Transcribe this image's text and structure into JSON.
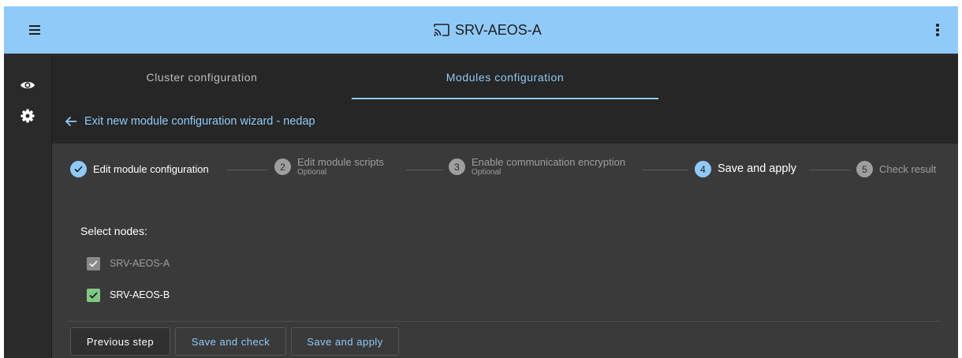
{
  "app": {
    "title": "SRV-AEOS-A",
    "colors": {
      "primary": "#90caf9",
      "success": "#81c784",
      "surface": "#3a3a3a"
    }
  },
  "icons": {
    "menu": "hamburger-menu-icon",
    "cast": "cast-icon",
    "more": "more-vertical-icon",
    "eye": "eye-icon",
    "settings": "gear-icon",
    "back": "arrow-left-icon",
    "check": "check-icon"
  },
  "tabs": [
    {
      "label": "Cluster configuration",
      "active": false
    },
    {
      "label": "Modules configuration",
      "active": true
    }
  ],
  "wizard": {
    "exit_label": "Exit new module configuration wizard - nedap",
    "steps": [
      {
        "number": "1",
        "label": "Edit module configuration",
        "sublabel": "",
        "state": "done"
      },
      {
        "number": "2",
        "label": "Edit module scripts",
        "sublabel": "Optional",
        "state": "pending"
      },
      {
        "number": "3",
        "label": "Enable communication encryption",
        "sublabel": "Optional",
        "state": "pending"
      },
      {
        "number": "4",
        "label": "Save and apply",
        "sublabel": "",
        "state": "active"
      },
      {
        "number": "5",
        "label": "Check result",
        "sublabel": "",
        "state": "pending"
      }
    ]
  },
  "nodes": {
    "label": "Select nodes:",
    "items": [
      {
        "name": "SRV-AEOS-A",
        "checked": true,
        "disabled": true
      },
      {
        "name": "SRV-AEOS-B",
        "checked": true,
        "disabled": false
      }
    ]
  },
  "actions": {
    "previous": "Previous step",
    "save_check": "Save and check",
    "save_apply": "Save and apply"
  }
}
